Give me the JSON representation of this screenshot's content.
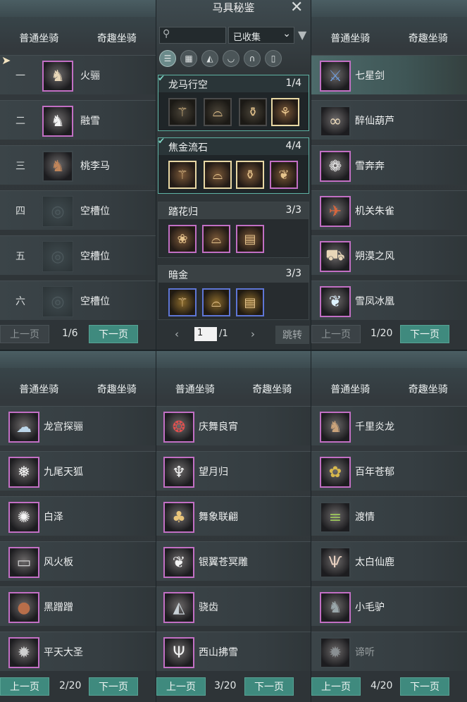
{
  "window_title": "马具秘鉴",
  "tabs": {
    "normal": "普通坐骑",
    "fun": "奇趣坐骑"
  },
  "nav": {
    "prev": "上一页",
    "next": "下一页"
  },
  "panel1": {
    "rows": [
      {
        "num": "一",
        "name": "火骊",
        "icon": "horse-icon"
      },
      {
        "num": "二",
        "name": "融雪",
        "icon": "white-horse-icon"
      },
      {
        "num": "三",
        "name": "桃李马",
        "icon": "horse-icon"
      },
      {
        "num": "四",
        "name": "空槽位",
        "icon": "empty-slot-icon"
      },
      {
        "num": "五",
        "name": "空槽位",
        "icon": "empty-slot-icon"
      },
      {
        "num": "六",
        "name": "空槽位",
        "icon": "empty-slot-icon"
      }
    ],
    "page": "1/6"
  },
  "collection": {
    "search_placeholder": "",
    "filter_value": "已收集",
    "sets": [
      {
        "name": "龙马行空",
        "count": "1/4"
      },
      {
        "name": "焦金流石",
        "count": "4/4"
      },
      {
        "name": "踏花归",
        "count": "3/3"
      },
      {
        "name": "暗金",
        "count": "3/3"
      }
    ],
    "page_input": "1",
    "page_total": "/1",
    "jump": "跳转"
  },
  "panel3": {
    "rows": [
      "七星剑",
      "醉仙葫芦",
      "雪奔奔",
      "机关朱雀",
      "朔漠之风",
      "雪凤冰凰"
    ],
    "page": "1/20"
  },
  "panel4": {
    "rows": [
      "龙宫探骊",
      "九尾天狐",
      "白泽",
      "风火板",
      "黑蹭蹭",
      "平天大圣"
    ],
    "page": "2/20"
  },
  "panel5": {
    "rows": [
      "庆舞良宵",
      "望月归",
      "舞象联翩",
      "银翼苍冥雕",
      "骁齿",
      "西山拂雪"
    ],
    "page": "3/20"
  },
  "panel6": {
    "rows": [
      "千里炎龙",
      "百年苍郁",
      "渡情",
      "太白仙鹿",
      "小毛驴",
      "谛听"
    ],
    "page": "4/20"
  },
  "colors": {
    "accent": "#3f8a7e",
    "rarity_purple": "#c26fc4",
    "rarity_gold": "#e8d8a4",
    "rarity_blue": "#5e76d6"
  }
}
